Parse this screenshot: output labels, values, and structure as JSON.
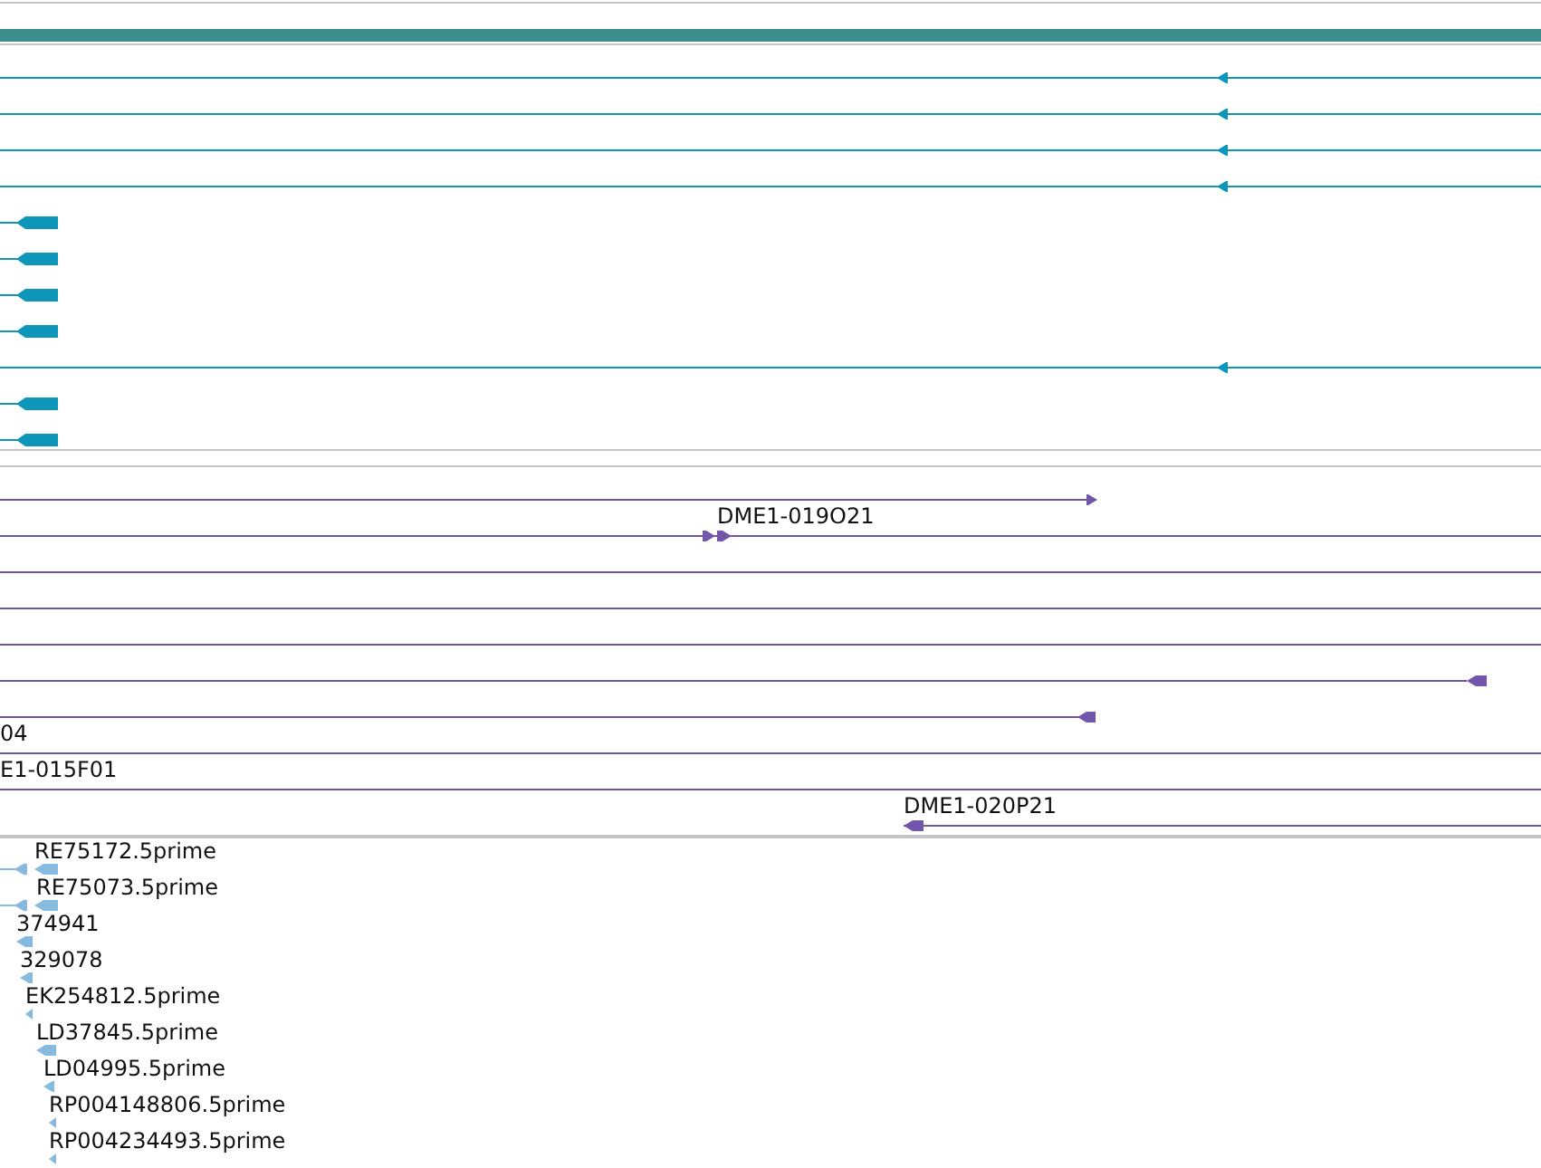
{
  "tracks": [
    {
      "color": "#0e96b8",
      "features": [
        {
          "head": true,
          "reverse": true
        },
        {
          "head": true,
          "reverse": true
        },
        {
          "head": true,
          "reverse": true
        },
        {
          "head": true,
          "reverse": true
        },
        {
          "head": true,
          "reverse": true
        },
        {
          "head": true,
          "reverse": true
        },
        {
          "head": true,
          "reverse": true
        },
        {
          "head": true,
          "reverse": true
        },
        {
          "head": true,
          "reverse": true
        },
        {
          "head": true,
          "reverse": true
        },
        {
          "head": true,
          "reverse": true
        }
      ]
    },
    {
      "color": "#7256aa",
      "features": [
        {
          "head": true,
          "reverse": false
        },
        {
          "label": "DME1-019O21",
          "head": true,
          "reverse": false
        },
        {
          "head": false
        },
        {
          "head": false
        },
        {
          "head": false
        },
        {
          "head": true,
          "reverse": true
        },
        {
          "head": true,
          "reverse": true
        },
        {
          "label": "04",
          "head": false
        },
        {
          "label": "E1-015F01",
          "head": false
        },
        {
          "label": "DME1-020P21",
          "head": true,
          "reverse": true
        }
      ]
    },
    {
      "color": "#86bbdf",
      "features": [
        {
          "label": "RE75172.5prime",
          "head": true,
          "reverse": true
        },
        {
          "label": "RE75073.5prime",
          "head": true,
          "reverse": true
        },
        {
          "label": "374941",
          "head": true,
          "reverse": true
        },
        {
          "label": "329078",
          "head": true,
          "reverse": true
        },
        {
          "label": "EK254812.5prime",
          "head": true,
          "reverse": true
        },
        {
          "label": "LD37845.5prime",
          "head": true,
          "reverse": true
        },
        {
          "label": "LD04995.5prime",
          "head": true,
          "reverse": true
        },
        {
          "label": "RP004148806.5prime",
          "head": true,
          "reverse": true
        },
        {
          "label": "RP004234493.5prime",
          "head": true,
          "reverse": true
        }
      ]
    }
  ]
}
